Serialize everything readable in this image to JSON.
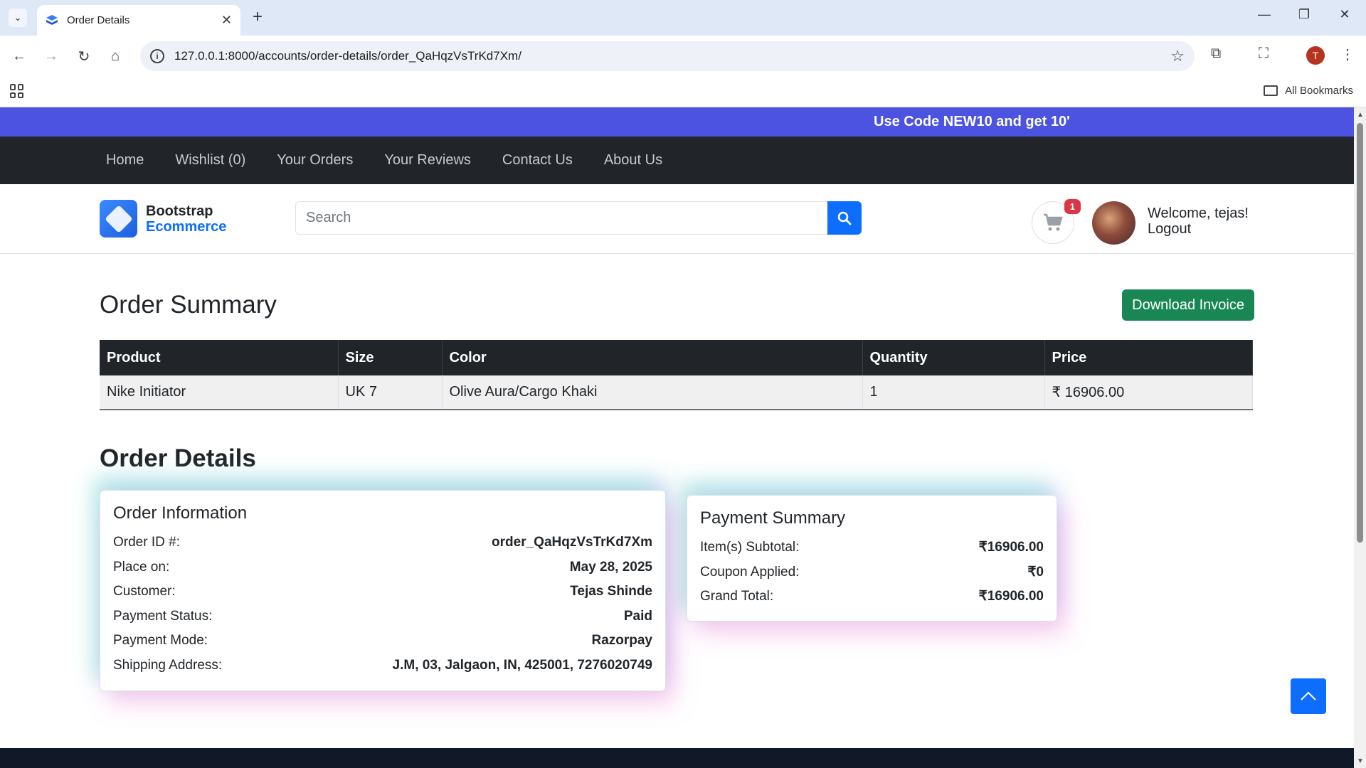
{
  "browser": {
    "tab_title": "Order Details",
    "url": "127.0.0.1:8000/accounts/order-details/order_QaHqzVsTrKd7Xm/",
    "profile_initial": "T",
    "all_bookmarks": "All Bookmarks"
  },
  "promo": {
    "text": "Use Code NEW10 and get 10'"
  },
  "nav": {
    "items": [
      "Home",
      "Wishlist (0)",
      "Your Orders",
      "Your Reviews",
      "Contact Us",
      "About Us"
    ]
  },
  "header": {
    "logo_line1": "Bootstrap",
    "logo_line2": "Ecommerce",
    "search_placeholder": "Search",
    "cart_count": "1",
    "welcome": "Welcome, tejas!",
    "logout": "Logout"
  },
  "summary": {
    "title": "Order Summary",
    "download_label": "Download Invoice",
    "columns": [
      "Product",
      "Size",
      "Color",
      "Quantity",
      "Price"
    ],
    "rows": [
      [
        "Nike Initiator",
        "UK 7",
        "Olive Aura/Cargo Khaki",
        "1",
        "₹ 16906.00"
      ]
    ]
  },
  "details": {
    "title": "Order Details",
    "order_info": {
      "title": "Order Information",
      "fields": [
        {
          "label": "Order ID #:",
          "value": "order_QaHqzVsTrKd7Xm"
        },
        {
          "label": "Place on:",
          "value": "May 28, 2025"
        },
        {
          "label": "Customer:",
          "value": "Tejas Shinde"
        },
        {
          "label": "Payment Status:",
          "value": "Paid"
        },
        {
          "label": "Payment Mode:",
          "value": "Razorpay"
        },
        {
          "label": "Shipping Address:",
          "value": "J.M, 03, Jalgaon, IN, 425001, 7276020749"
        }
      ]
    },
    "payment": {
      "title": "Payment Summary",
      "fields": [
        {
          "label": "Item(s) Subtotal:",
          "value": "₹16906.00"
        },
        {
          "label": "Coupon Applied:",
          "value": "₹0"
        },
        {
          "label": "Grand Total:",
          "value": "₹16906.00"
        }
      ]
    }
  },
  "colors": {
    "promo_bg": "#4b53e0",
    "nav_bg": "#212529",
    "primary": "#0d6efd",
    "success": "#198754",
    "badge": "#dc3545"
  }
}
